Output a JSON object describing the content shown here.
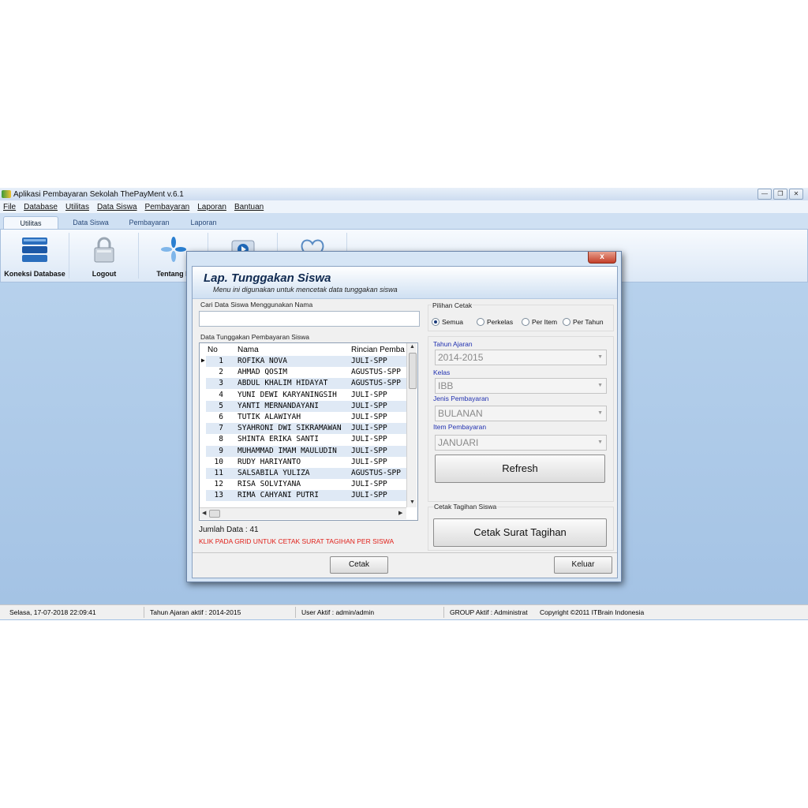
{
  "window": {
    "title": "Aplikasi Pembayaran Sekolah ThePayMent v.6.1"
  },
  "menu": [
    "File",
    "Database",
    "Utilitas",
    "Data Siswa",
    "Pembayaran",
    "Laporan",
    "Bantuan"
  ],
  "ribbon_tabs": [
    "Utilitas",
    "Data Siswa",
    "Pembayaran",
    "Laporan"
  ],
  "ribbon_buttons": {
    "koneksi": "Koneksi Database",
    "logout": "Logout",
    "tentang": "Tentang K"
  },
  "dialog": {
    "title": "Lap. Tunggakan Siswa",
    "subtitle": "Menu ini digunakan untuk mencetak data tunggakan siswa",
    "search_label": "Cari Data Siswa Menggunakan Nama",
    "search_value": "",
    "grid_label": "Data Tunggakan Pembayaran Siswa",
    "columns": {
      "no": "No",
      "nama": "Nama",
      "rincian": "Rincian Pemba"
    },
    "rows": [
      {
        "no": "1",
        "nama": "ROFIKA NOVA",
        "rincian": "JULI-SPP"
      },
      {
        "no": "2",
        "nama": "AHMAD QOSIM",
        "rincian": "AGUSTUS-SPP"
      },
      {
        "no": "3",
        "nama": "ABDUL KHALIM HIDAYAT",
        "rincian": "AGUSTUS-SPP"
      },
      {
        "no": "4",
        "nama": "YUNI DEWI KARYANINGSIH",
        "rincian": "JULI-SPP"
      },
      {
        "no": "5",
        "nama": "YANTI MERNANDAYANI",
        "rincian": "JULI-SPP"
      },
      {
        "no": "6",
        "nama": "TUTIK ALAWIYAH",
        "rincian": "JULI-SPP"
      },
      {
        "no": "7",
        "nama": "SYAHRONI DWI SIKRAMAWAN",
        "rincian": "JULI-SPP"
      },
      {
        "no": "8",
        "nama": "SHINTA ERIKA SANTI",
        "rincian": "JULI-SPP"
      },
      {
        "no": "9",
        "nama": "MUHAMMAD IMAM MAULUDIN",
        "rincian": "JULI-SPP"
      },
      {
        "no": "10",
        "nama": "RUDY HARIYANTO",
        "rincian": "JULI-SPP"
      },
      {
        "no": "11",
        "nama": "SALSABILA YULIZA",
        "rincian": "AGUSTUS-SPP"
      },
      {
        "no": "12",
        "nama": "RISA SOLVIYANA",
        "rincian": "JULI-SPP"
      },
      {
        "no": "13",
        "nama": "RIMA CAHYANI PUTRI",
        "rincian": "JULI-SPP"
      }
    ],
    "jumlah": "Jumlah Data : 41",
    "klik_note": "KLIK PADA GRID UNTUK CETAK SURAT TAGIHAN PER SISWA",
    "pilihan_label": "Pilihan Cetak",
    "radios": [
      {
        "label": "Semua",
        "checked": true
      },
      {
        "label": "Perkelas",
        "checked": false
      },
      {
        "label": "Per Item",
        "checked": false
      },
      {
        "label": "Per Tahun",
        "checked": false
      }
    ],
    "tahun_label": "Tahun Ajaran",
    "tahun_value": "2014-2015",
    "kelas_label": "Kelas",
    "kelas_value": "IBB",
    "jenis_label": "Jenis Pembayaran",
    "jenis_value": "BULANAN",
    "item_label": "Item Pembayaran",
    "item_value": "JANUARI",
    "refresh": "Refresh",
    "cetak_tagihan_label": "Cetak Tagihan Siswa",
    "cetak_surat": "Cetak Surat Tagihan",
    "cetak": "Cetak",
    "keluar": "Keluar",
    "close": "x"
  },
  "status": {
    "date": "Selasa, 17-07-2018  22:09:41",
    "tahun": "Tahun Ajaran aktif :  2014-2015",
    "user": "User Aktif  : admin/admin",
    "group": "GROUP Aktif  : Administrat",
    "copyright": "Copyright ©2011 ITBrain Indonesia"
  },
  "colors": {
    "accent": "#1a3a7a",
    "warning": "#e0201a",
    "title": "#102a50"
  }
}
